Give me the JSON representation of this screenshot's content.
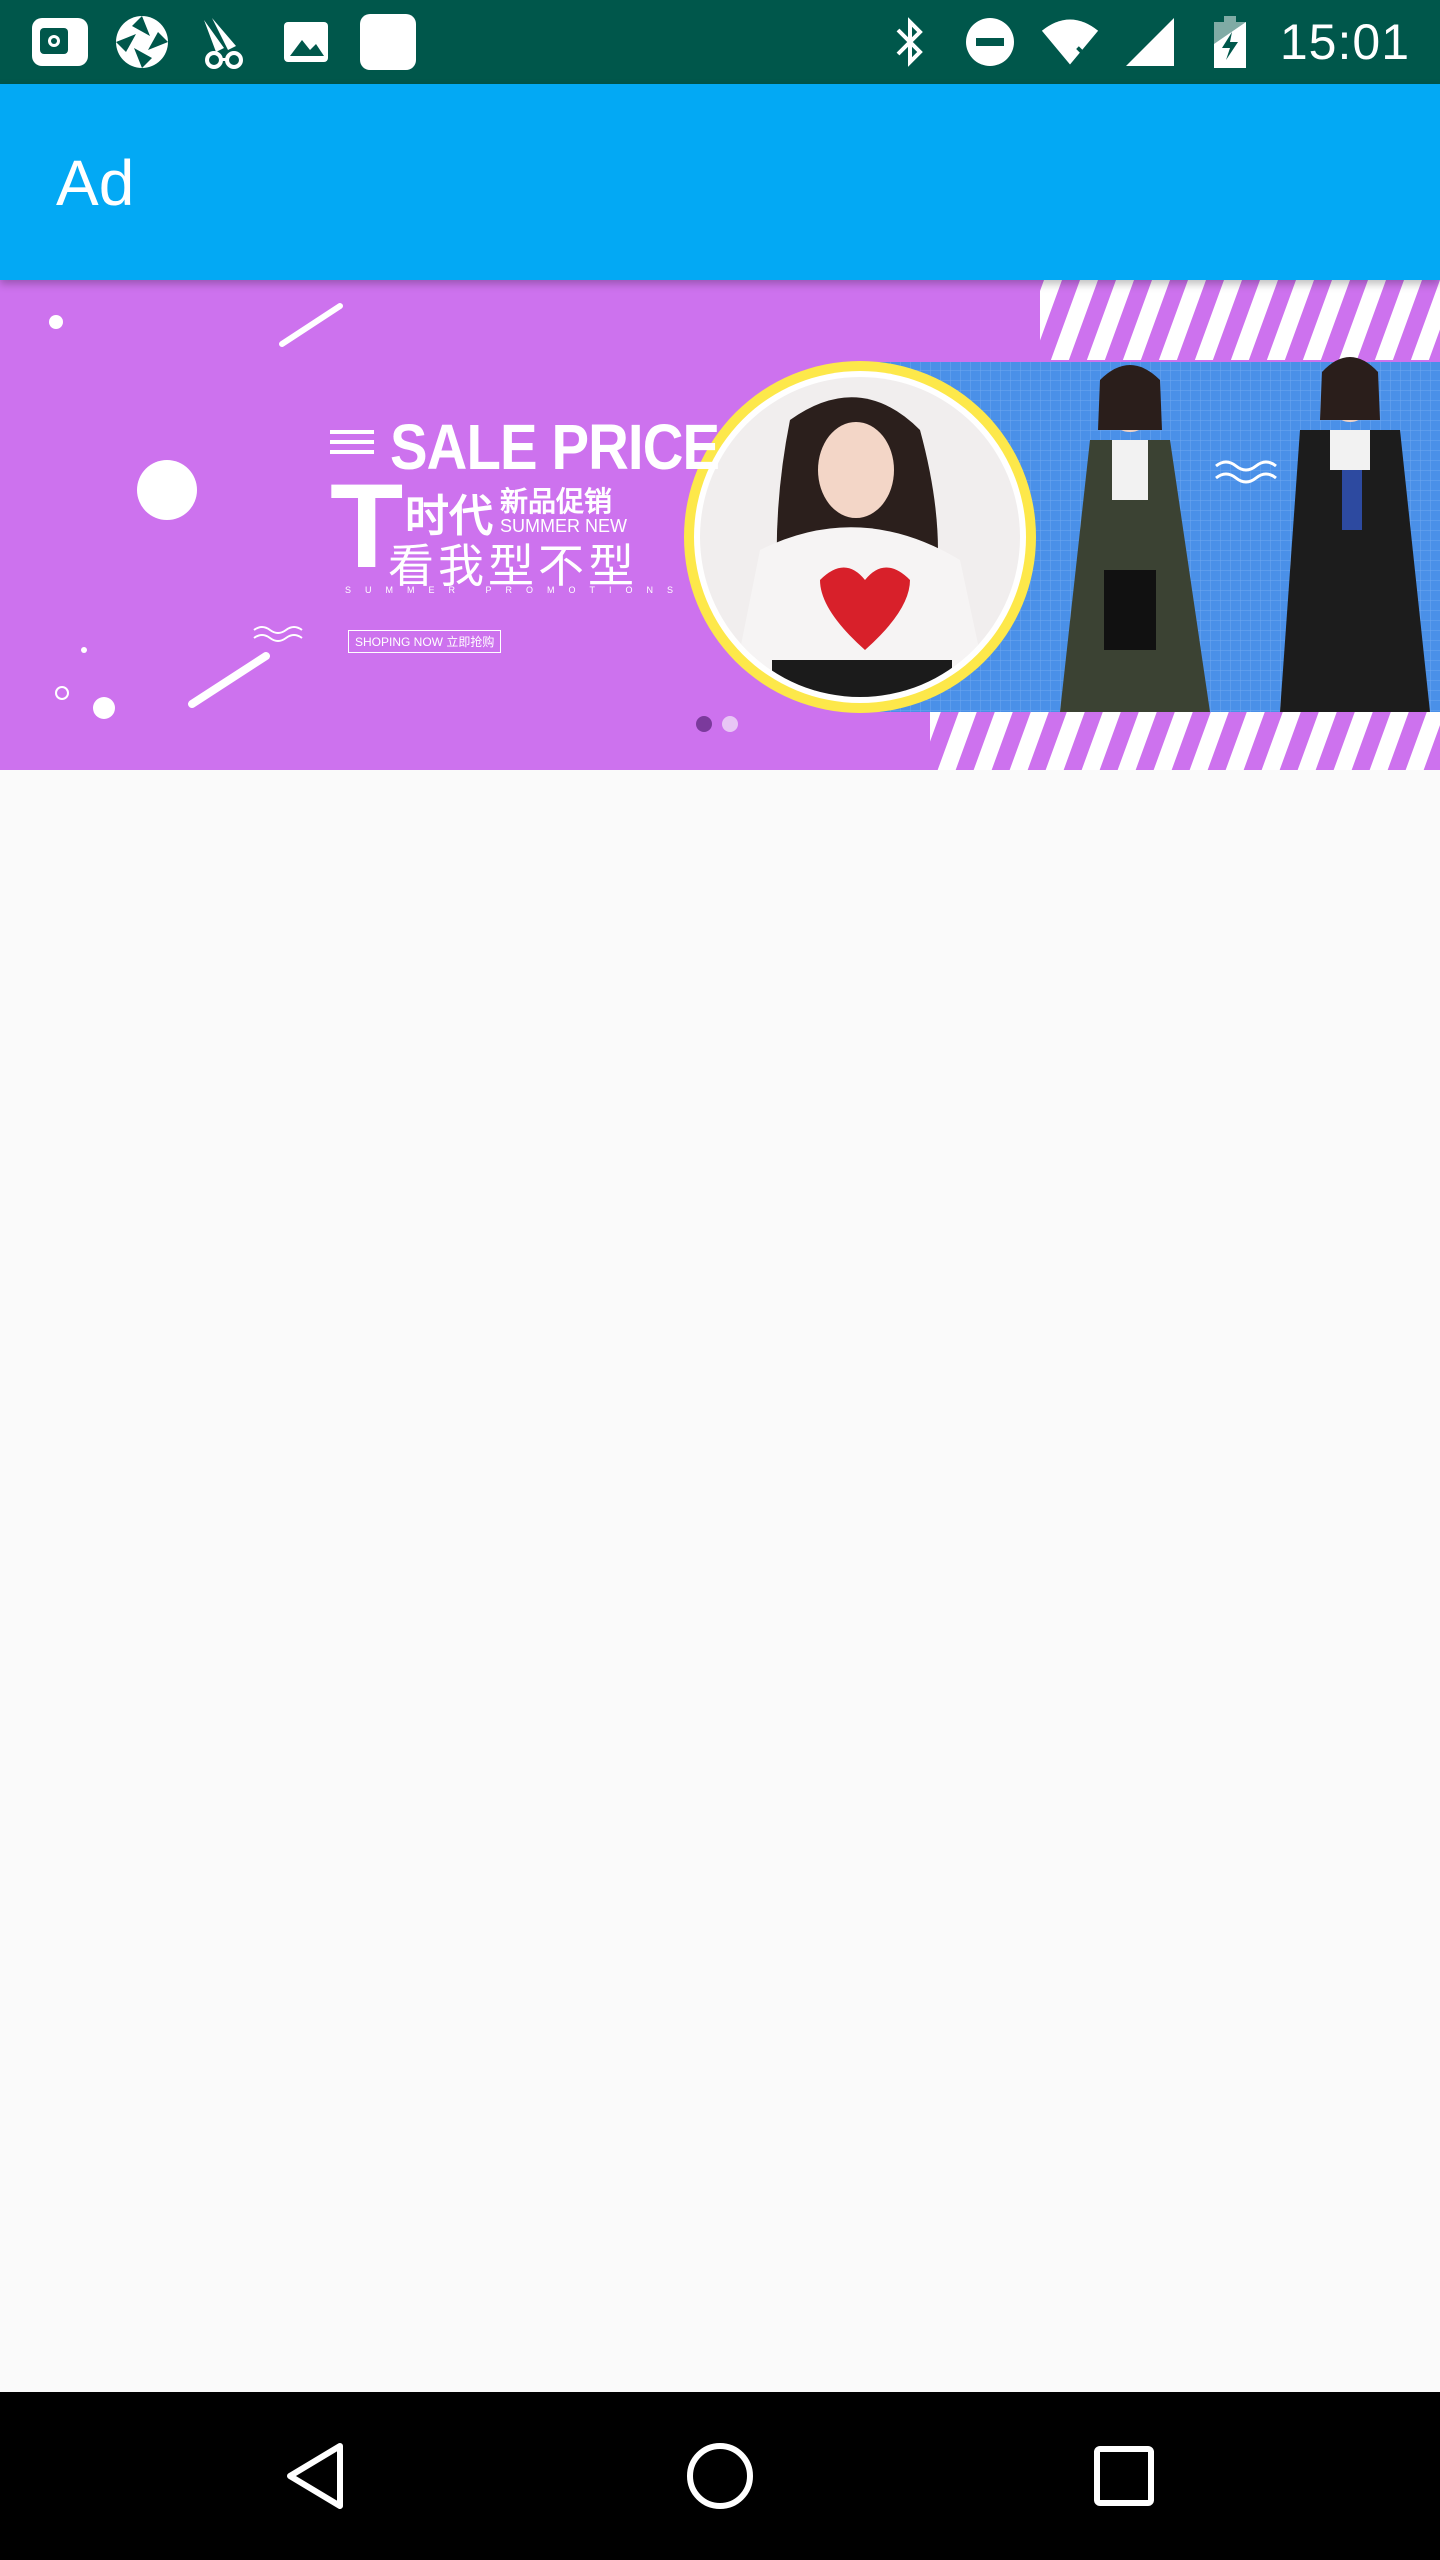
{
  "status_bar": {
    "time": "15:01",
    "left_icons": [
      "wallet-icon",
      "aperture-icon",
      "spy-icon",
      "image-icon",
      "blank-app-icon"
    ],
    "right_icons": [
      "bluetooth-icon",
      "do-not-disturb-icon",
      "wifi-icon",
      "signal-icon",
      "battery-icon"
    ]
  },
  "app_bar": {
    "title": "Ad"
  },
  "banner": {
    "headline": "SALE PRICE",
    "t_letter": "T",
    "era_text": "时代",
    "new_promo": "新品促销",
    "summer_new": "SUMMER NEW",
    "slogan": "看我型不型",
    "summer_promotions": "SUMMER PROMOTIONS",
    "shop_now": "SHOPING NOW 立即抢购",
    "page_count": 2,
    "current_page": 1,
    "colors": {
      "background": "#cd72ee",
      "photo_panel": "#4a90e8",
      "ring": "#fde84a",
      "dot_active": "#7b3a9c",
      "dot_inactive": "#e8c6f5"
    }
  },
  "nav_bar": {
    "buttons": [
      "back-icon",
      "home-icon",
      "recents-icon"
    ]
  },
  "colors": {
    "status_bar": "#00574b",
    "app_bar": "#03a9f4",
    "content_bg": "#fafafa",
    "nav_bar": "#000000"
  }
}
